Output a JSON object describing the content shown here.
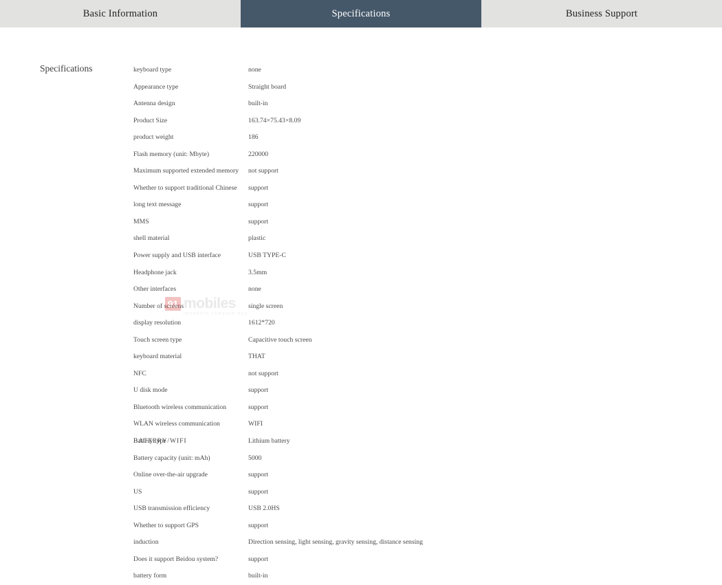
{
  "tabs": [
    {
      "label": "Basic Information",
      "active": false
    },
    {
      "label": "Specifications",
      "active": true
    },
    {
      "label": "Business Support",
      "active": false
    }
  ],
  "section": {
    "label": "Specifications"
  },
  "colors": {
    "tab_inactive_bg": "#e2e2e1",
    "tab_active_bg": "#45586a",
    "tab_active_text": "#ffffff",
    "tab_inactive_text": "#232323",
    "body_text": "#4a4a4a",
    "page_bg": "#ffffff",
    "watermark_badge": "#d83a3a",
    "watermark_word": "#b9b9b9"
  },
  "watermark": {
    "badge": "91",
    "word": "mobiles",
    "tagline": "research   compare   buy"
  },
  "specs": [
    {
      "key": "keyboard type",
      "value": "none"
    },
    {
      "key": "Appearance type",
      "value": "Straight board"
    },
    {
      "key": "Antenna design",
      "value": "built-in"
    },
    {
      "key": "Product Size",
      "value": "163.74×75.43×8.09"
    },
    {
      "key": "product weight",
      "value": "186"
    },
    {
      "key": "Flash memory (unit: Mbyte)",
      "value": "220000"
    },
    {
      "key": "Maximum supported extended memory",
      "value": "not support"
    },
    {
      "key": "Whether to support traditional Chinese",
      "value": "support"
    },
    {
      "key": "long text message",
      "value": "support"
    },
    {
      "key": "MMS",
      "value": "support"
    },
    {
      "key": "shell material",
      "value": "plastic"
    },
    {
      "key": "Power supply and USB interface",
      "value": "USB TYPE-C"
    },
    {
      "key": "Headphone jack",
      "value": "3.5mm"
    },
    {
      "key": "Other interfaces",
      "value": "none"
    },
    {
      "key": "Number of screens",
      "value": "single screen"
    },
    {
      "key": "display resolution",
      "value": "1612*720"
    },
    {
      "key": "Touch screen type",
      "value": "Capacitive touch screen"
    },
    {
      "key": "keyboard material",
      "value": "THAT"
    },
    {
      "key": "NFC",
      "value": "not support"
    },
    {
      "key": "U disk mode",
      "value": "support"
    },
    {
      "key": "Bluetooth wireless communication",
      "value": "support"
    },
    {
      "key": "WLAN wireless communication",
      "value": "WIFI"
    },
    {
      "key": "Battery type",
      "key_overlay": "BATTERY/WIFI",
      "overlap": true,
      "value": "Lithium battery"
    },
    {
      "key": "Battery capacity (unit: mAh)",
      "value": "5000"
    },
    {
      "key": "Online over-the-air upgrade",
      "value": "support"
    },
    {
      "key": "US",
      "value": "support"
    },
    {
      "key": "USB transmission efficiency",
      "value": "USB 2.0HS"
    },
    {
      "key": "Whether to support GPS",
      "value": "support"
    },
    {
      "key": "induction",
      "value": "Direction sensing, light sensing, gravity sensing, distance sensing"
    },
    {
      "key": "Does it support Beidou system?",
      "value": "support"
    },
    {
      "key": "battery form",
      "value": "built-in"
    }
  ]
}
